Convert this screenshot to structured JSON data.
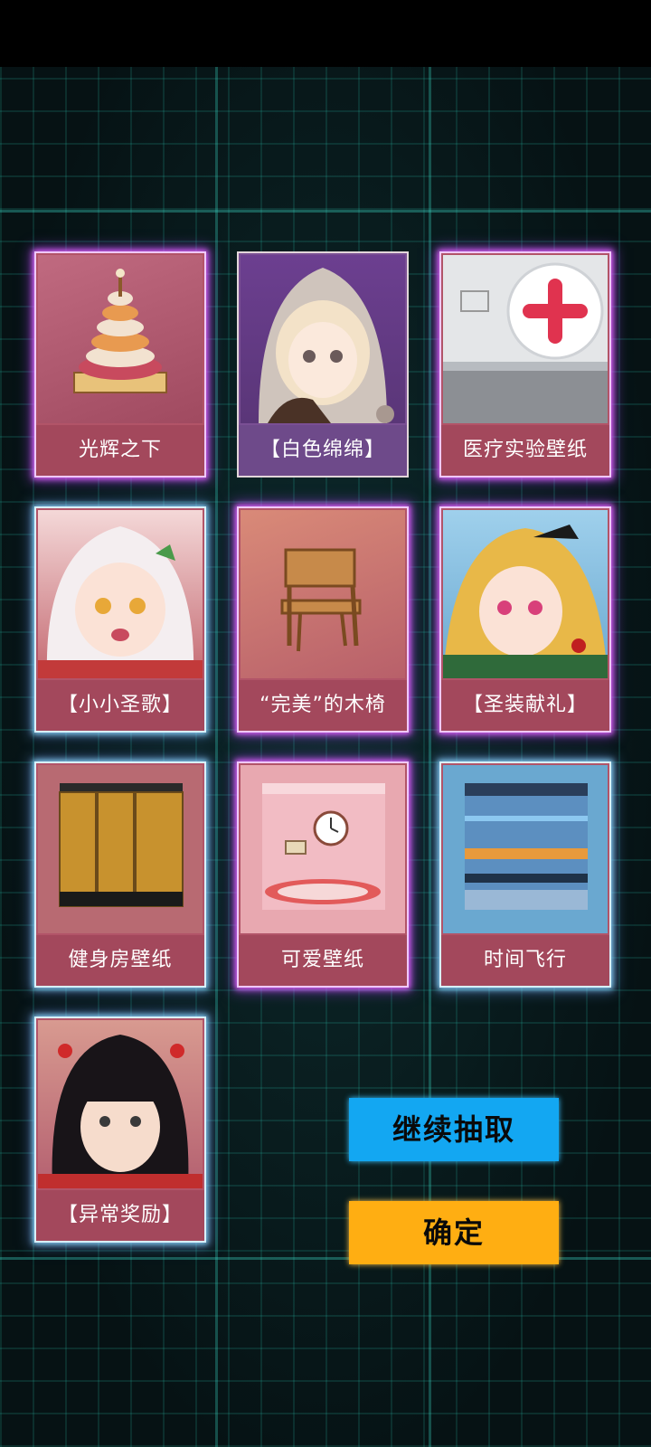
{
  "rewards": [
    {
      "name": "光辉之下"
    },
    {
      "name": "【白色绵绵】"
    },
    {
      "name": "医疗实验壁纸"
    },
    {
      "name": "【小小圣歌】"
    },
    {
      "name": "“完美”的木椅"
    },
    {
      "name": "【圣装献礼】"
    },
    {
      "name": "健身房壁纸"
    },
    {
      "name": "可爱壁纸"
    },
    {
      "name": "时间飞行"
    },
    {
      "name": "【异常奖励】"
    }
  ],
  "buttons": {
    "continue_label": "继续抽取",
    "confirm_label": "确定"
  },
  "colors": {
    "card_pink": "#b25468",
    "card_purple": "#7a4f94",
    "continue_button": "#13a7f2",
    "confirm_button": "#ffae12",
    "glow_purple": "#e064ff",
    "glow_blue": "#8cdcff"
  }
}
